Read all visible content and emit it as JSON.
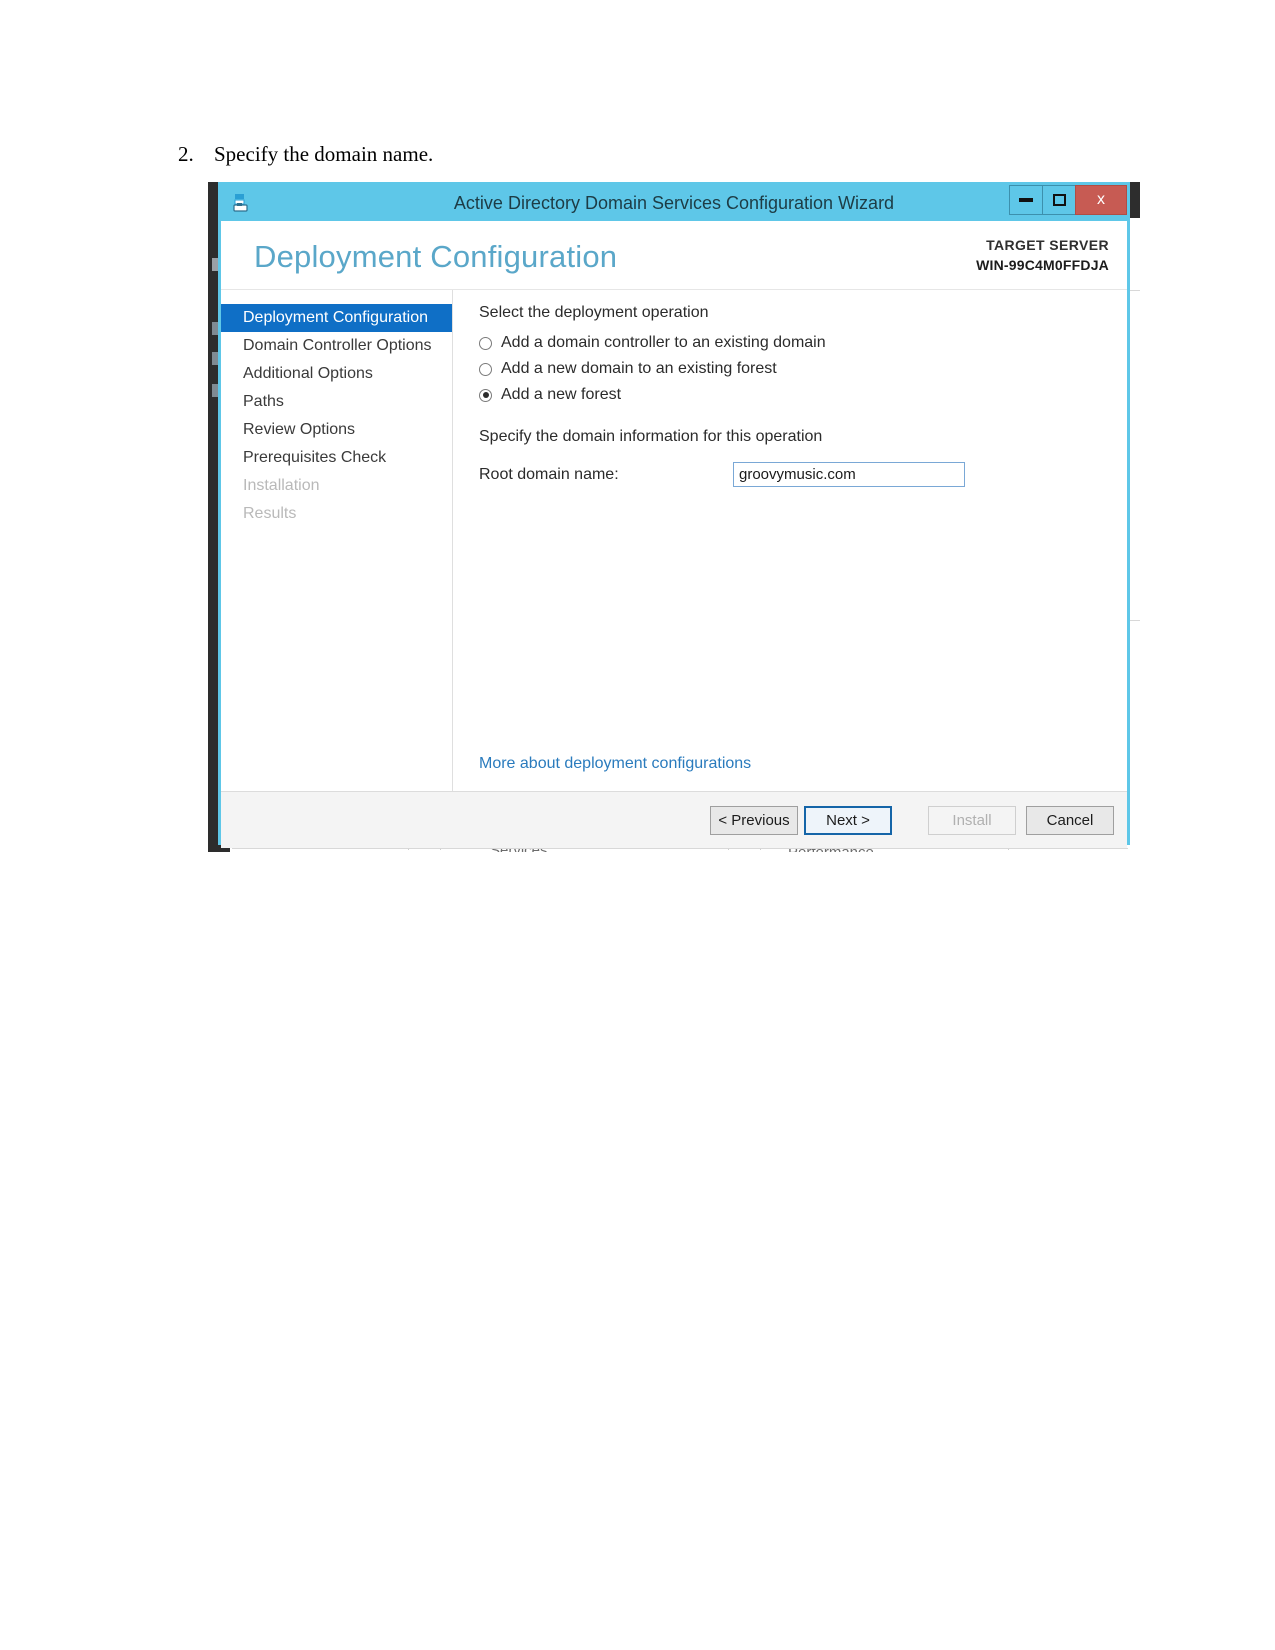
{
  "document": {
    "step_number": "2.",
    "step_text": "Specify the domain name."
  },
  "window": {
    "title": "Active Directory Domain Services Configuration Wizard",
    "icon": "server-wizard-icon",
    "minimize_label": "",
    "maximize_label": "",
    "close_label": "x",
    "titlebar_color": "#5ec7e8",
    "close_color": "#c75b53"
  },
  "header": {
    "page_title": "Deployment Configuration",
    "target_server_label": "TARGET SERVER",
    "target_server_name": "WIN-99C4M0FFDJA",
    "title_color": "#5aa7c9"
  },
  "nav": {
    "items": [
      {
        "label": "Deployment Configuration",
        "state": "active"
      },
      {
        "label": "Domain Controller Options",
        "state": "enabled"
      },
      {
        "label": "Additional Options",
        "state": "enabled"
      },
      {
        "label": "Paths",
        "state": "enabled"
      },
      {
        "label": "Review Options",
        "state": "enabled"
      },
      {
        "label": "Prerequisites Check",
        "state": "enabled"
      },
      {
        "label": "Installation",
        "state": "disabled"
      },
      {
        "label": "Results",
        "state": "disabled"
      }
    ],
    "active_color": "#0f6fc6"
  },
  "pane": {
    "operation_heading": "Select the deployment operation",
    "options": [
      {
        "label": "Add a domain controller to an existing domain",
        "checked": false
      },
      {
        "label": "Add a new domain to an existing forest",
        "checked": false
      },
      {
        "label": "Add a new forest",
        "checked": true
      }
    ],
    "domain_info_heading": "Specify the domain information for this operation",
    "root_domain_label": "Root domain name:",
    "root_domain_value": "groovymusic.com",
    "root_domain_placeholder": "",
    "more_link": "More about deployment configurations"
  },
  "footer": {
    "previous_label": "< Previous",
    "next_label": "Next >",
    "install_label": "Install",
    "cancel_label": "Cancel"
  },
  "background": {
    "services_label": "Services",
    "performance_label": "Performance"
  }
}
